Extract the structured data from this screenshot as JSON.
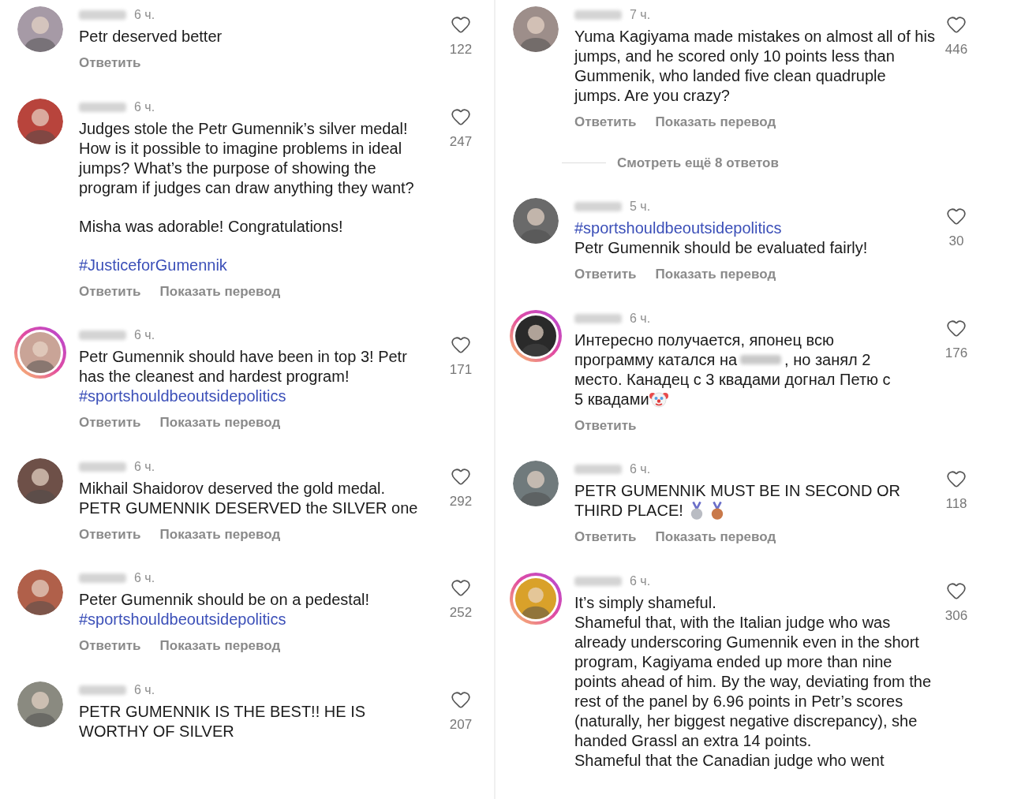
{
  "columns": [
    {
      "comments": [
        {
          "avatar": {
            "kind": "plain"
          },
          "time": "6 ч.",
          "paragraphs": [
            {
              "kind": "line",
              "parts": [
                {
                  "kind": "text",
                  "text": "Petr deserved better"
                }
              ]
            }
          ],
          "actions": [
            "Ответить"
          ],
          "likes": "122"
        },
        {
          "avatar": {
            "kind": "plain"
          },
          "time": "6 ч.",
          "paragraphs": [
            {
              "kind": "line",
              "parts": [
                {
                  "kind": "text",
                  "text": "Judges stole the Petr Gumennik’s silver medal! How is it possible to imagine problems in ideal jumps? What’s the purpose of showing the program if judges can draw anything they want?"
                }
              ]
            },
            {
              "kind": "blank"
            },
            {
              "kind": "line",
              "parts": [
                {
                  "kind": "text",
                  "text": "Misha was adorable! Congratulations!"
                }
              ]
            },
            {
              "kind": "blank"
            },
            {
              "kind": "line",
              "parts": [
                {
                  "kind": "hashtag",
                  "text": "#JusticeforGumennik"
                }
              ]
            }
          ],
          "actions": [
            "Ответить",
            "Показать перевод"
          ],
          "likes": "247"
        },
        {
          "avatar": {
            "kind": "ring"
          },
          "time": "6 ч.",
          "paragraphs": [
            {
              "kind": "line",
              "parts": [
                {
                  "kind": "text",
                  "text": "Petr Gumennik should have been in top 3! Petr has the cleanest and hardest program!"
                }
              ]
            },
            {
              "kind": "line",
              "parts": [
                {
                  "kind": "hashtag",
                  "text": "#sportshouldbeoutsidepolitics"
                }
              ]
            }
          ],
          "actions": [
            "Ответить",
            "Показать перевод"
          ],
          "likes": "171"
        },
        {
          "avatar": {
            "kind": "plain"
          },
          "time": "6 ч.",
          "paragraphs": [
            {
              "kind": "line",
              "parts": [
                {
                  "kind": "text",
                  "text": "Mikhail Shaidorov deserved the gold medal. PETR GUMENNIK DESERVED the SILVER one"
                }
              ]
            }
          ],
          "actions": [
            "Ответить",
            "Показать перевод"
          ],
          "likes": "292"
        },
        {
          "avatar": {
            "kind": "plain"
          },
          "time": "6 ч.",
          "paragraphs": [
            {
              "kind": "line",
              "parts": [
                {
                  "kind": "text",
                  "text": "Peter Gumennik should be on a pedestal!"
                }
              ]
            },
            {
              "kind": "line",
              "parts": [
                {
                  "kind": "hashtag",
                  "text": "#sportshouldbeoutsidepolitics"
                }
              ]
            }
          ],
          "actions": [
            "Ответить",
            "Показать перевод"
          ],
          "likes": "252"
        },
        {
          "avatar": {
            "kind": "plain"
          },
          "time": "6 ч.",
          "paragraphs": [
            {
              "kind": "line",
              "parts": [
                {
                  "kind": "text",
                  "text": "PETR GUMENNIK IS THE BEST!! HE IS WORTHY OF SILVER"
                }
              ]
            }
          ],
          "likes": "207"
        }
      ]
    },
    {
      "comments": [
        {
          "avatar": {
            "kind": "plain"
          },
          "time": "7 ч.",
          "paragraphs": [
            {
              "kind": "line",
              "parts": [
                {
                  "kind": "text",
                  "text": "Yuma Kagiyama made mistakes on almost all of his jumps, and he scored only 10 points less than Gummenik, who landed five clean quadruple jumps. Are you crazy?"
                }
              ]
            }
          ],
          "actions": [
            "Ответить",
            "Показать перевод"
          ],
          "likes": "446",
          "more_replies": "Смотреть ещё 8 ответов"
        },
        {
          "avatar": {
            "kind": "plain"
          },
          "time": "5 ч.",
          "paragraphs": [
            {
              "kind": "line",
              "parts": [
                {
                  "kind": "hashtag",
                  "text": "#sportshouldbeoutsidepolitics"
                }
              ]
            },
            {
              "kind": "line",
              "parts": [
                {
                  "kind": "text",
                  "text": "Petr Gumennik should be evaluated fairly!"
                }
              ]
            }
          ],
          "actions": [
            "Ответить",
            "Показать перевод"
          ],
          "likes": "30"
        },
        {
          "avatar": {
            "kind": "ring"
          },
          "time": "6 ч.",
          "paragraphs": [
            {
              "kind": "line",
              "parts": [
                {
                  "kind": "text",
                  "text": "Интересно получается, японец всю"
                }
              ]
            },
            {
              "kind": "line",
              "parts": [
                {
                  "kind": "text",
                  "text": "программу катался на"
                },
                {
                  "kind": "blur"
                },
                {
                  "kind": "text",
                  "text": ", но занял 2"
                }
              ]
            },
            {
              "kind": "line",
              "parts": [
                {
                  "kind": "text",
                  "text": "место. Канадец с 3 квадами догнал Петю с"
                }
              ]
            },
            {
              "kind": "line",
              "parts": [
                {
                  "kind": "text",
                  "text": "5 квадами"
                },
                {
                  "kind": "clown"
                }
              ]
            }
          ],
          "actions": [
            "Ответить"
          ],
          "likes": "176"
        },
        {
          "avatar": {
            "kind": "plain"
          },
          "time": "6 ч.",
          "paragraphs": [
            {
              "kind": "line",
              "parts": [
                {
                  "kind": "text",
                  "text": "PETR GUMENNIK MUST BE IN SECOND OR"
                }
              ]
            },
            {
              "kind": "line",
              "parts": [
                {
                  "kind": "text",
                  "text": "THIRD PLACE!"
                },
                {
                  "kind": "silver-medal"
                },
                {
                  "kind": "bronze-medal"
                }
              ]
            }
          ],
          "actions": [
            "Ответить",
            "Показать перевод"
          ],
          "likes": "118"
        },
        {
          "avatar": {
            "kind": "ring"
          },
          "time": "6 ч.",
          "paragraphs": [
            {
              "kind": "line",
              "parts": [
                {
                  "kind": "text",
                  "text": "It’s simply shameful."
                }
              ]
            },
            {
              "kind": "line",
              "parts": [
                {
                  "kind": "text",
                  "text": "Shameful that, with the Italian judge who was already underscoring Gumennik even in the short program, Kagiyama ended up more than nine points ahead of him. By the way, deviating from the rest of the panel by 6.96 points in Petr’s scores (naturally, her biggest negative discrepancy), she handed Grassl an extra 14 points."
                }
              ]
            },
            {
              "kind": "line",
              "parts": [
                {
                  "kind": "text",
                  "text": "Shameful that the Canadian judge who went"
                }
              ]
            }
          ],
          "likes": "306"
        }
      ]
    }
  ]
}
